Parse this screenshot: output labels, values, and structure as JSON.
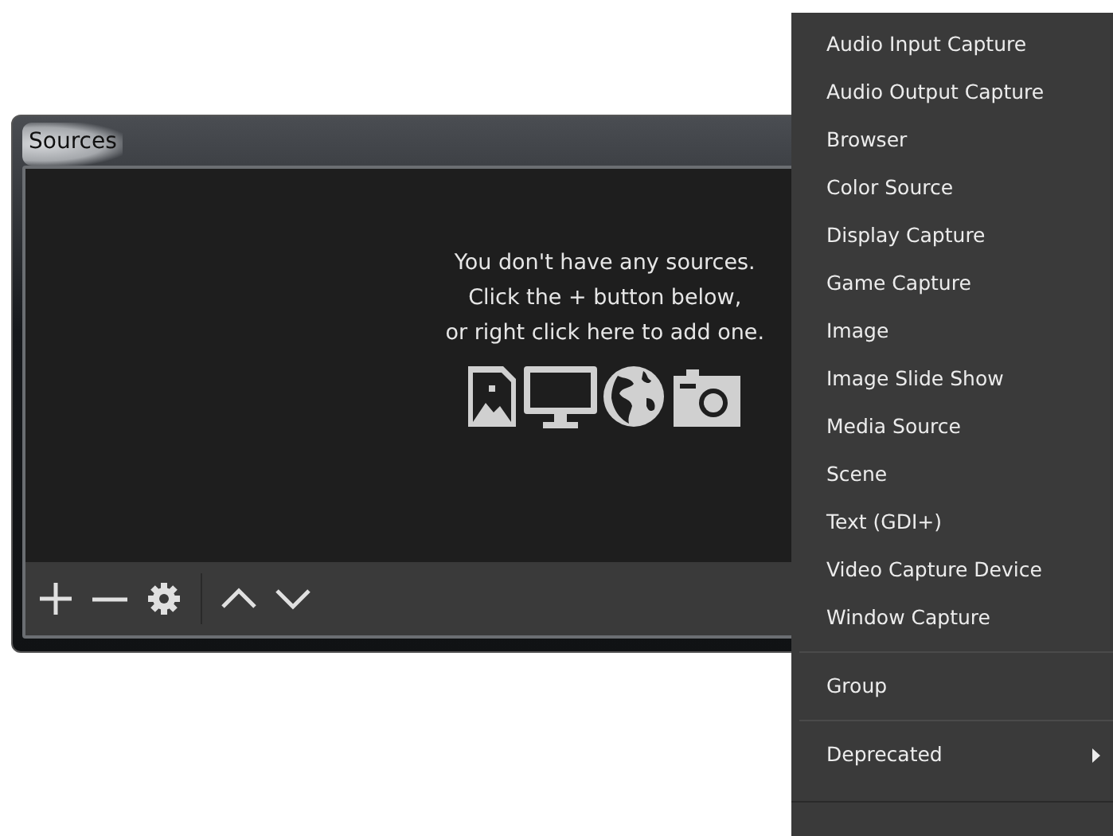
{
  "window": {
    "title": "Sources"
  },
  "empty_message": [
    "You don't have any sources.",
    "Click the + button below,",
    "or right click here to add one."
  ],
  "source_icons": [
    {
      "kind": "image"
    },
    {
      "kind": "monitor"
    },
    {
      "kind": "globe"
    },
    {
      "kind": "camera"
    }
  ],
  "toolbar": [
    {
      "kind": "add"
    },
    {
      "kind": "remove"
    },
    {
      "kind": "settings"
    },
    {
      "kind": "separator"
    },
    {
      "kind": "up"
    },
    {
      "kind": "down"
    }
  ],
  "context_menu": {
    "items": [
      {
        "kind": "item",
        "label": "Audio Input Capture"
      },
      {
        "kind": "item",
        "label": "Audio Output Capture"
      },
      {
        "kind": "item",
        "label": "Browser"
      },
      {
        "kind": "item",
        "label": "Color Source"
      },
      {
        "kind": "item",
        "label": "Display Capture"
      },
      {
        "kind": "item",
        "label": "Game Capture"
      },
      {
        "kind": "item",
        "label": "Image"
      },
      {
        "kind": "item",
        "label": "Image Slide Show"
      },
      {
        "kind": "item",
        "label": "Media Source"
      },
      {
        "kind": "item",
        "label": "Scene"
      },
      {
        "kind": "item",
        "label": "Text (GDI+)"
      },
      {
        "kind": "item",
        "label": "Video Capture Device"
      },
      {
        "kind": "item",
        "label": "Window Capture"
      },
      {
        "kind": "separator"
      },
      {
        "kind": "item",
        "label": "Group"
      },
      {
        "kind": "separator"
      },
      {
        "kind": "submenu",
        "label": "Deprecated"
      }
    ]
  }
}
